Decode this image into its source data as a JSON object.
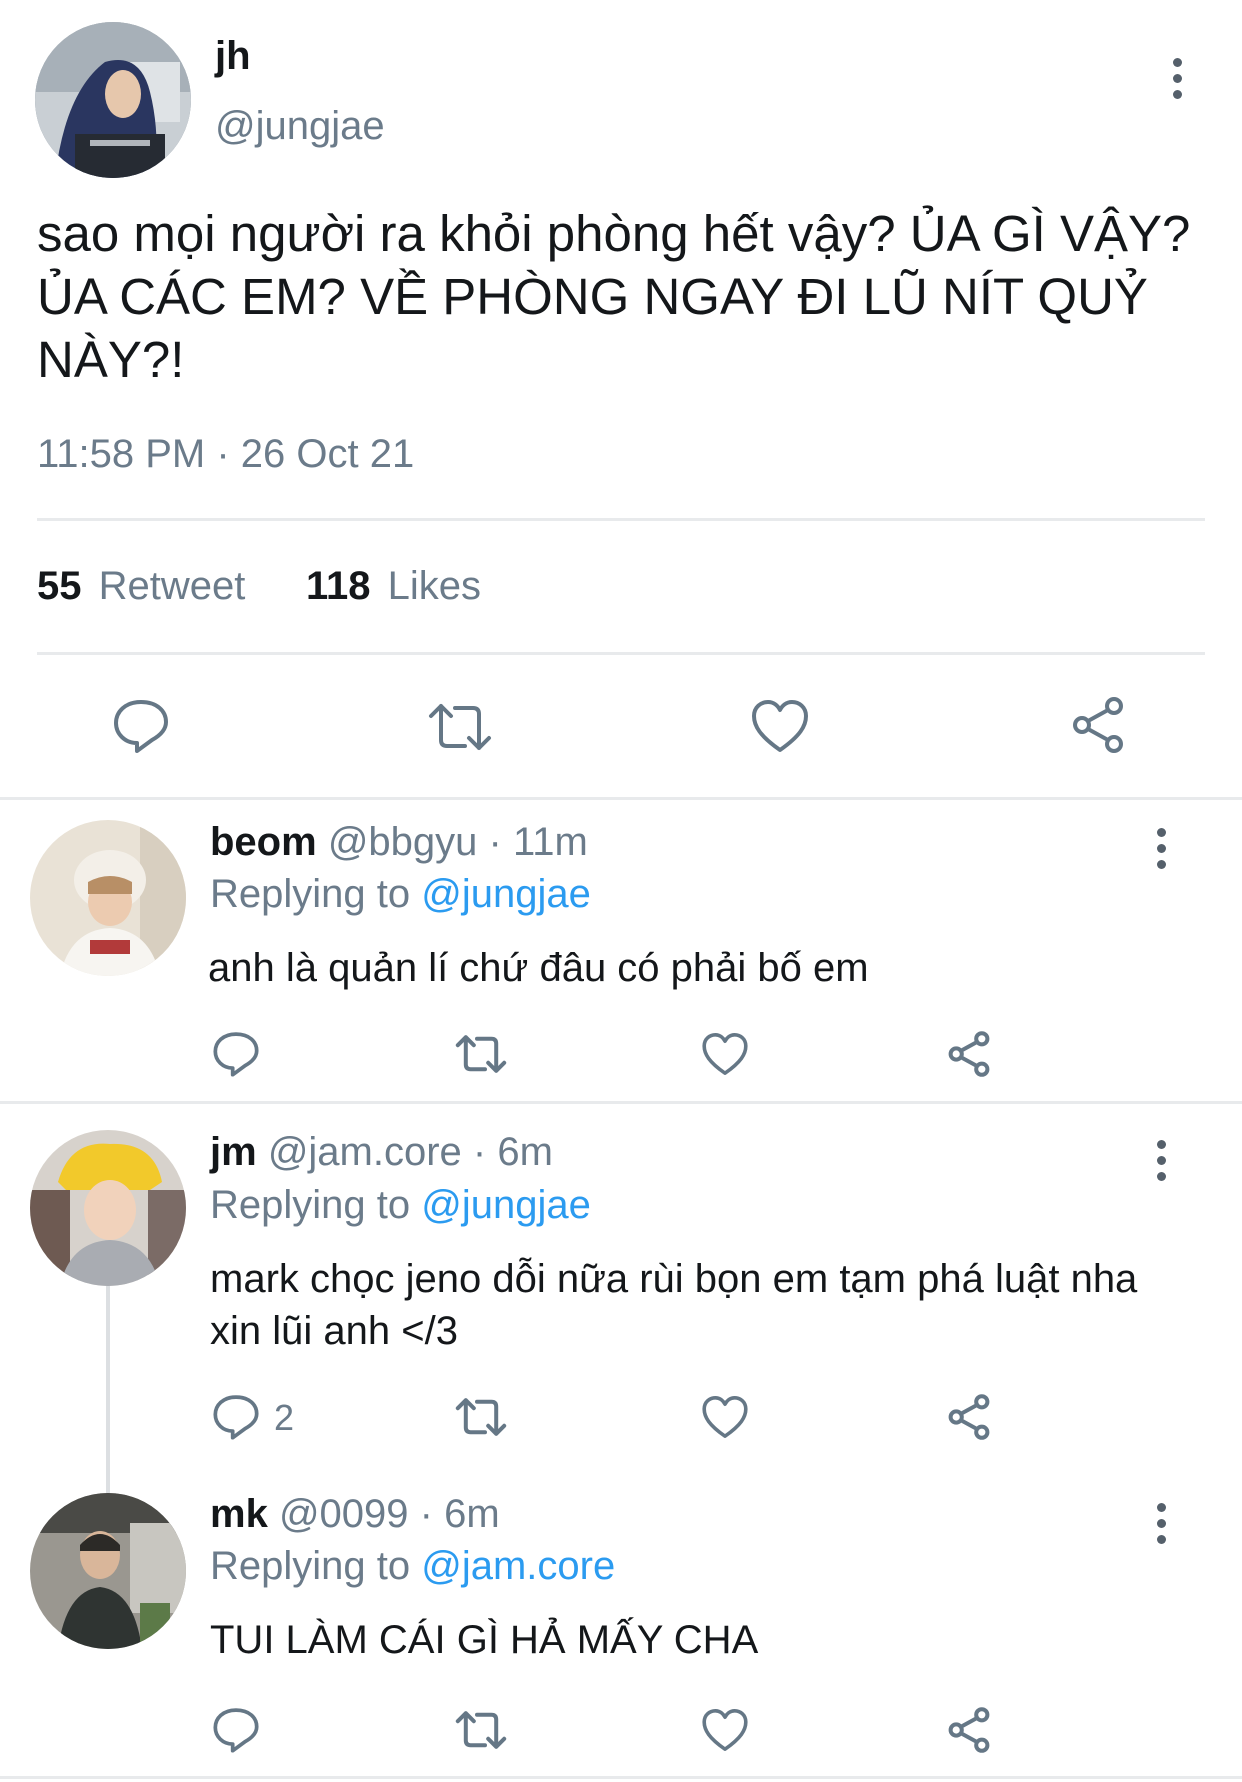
{
  "main_tweet": {
    "display_name": "jh",
    "handle": "@jungjae",
    "text": "sao mọi người ra khỏi phòng hết vậy? ỦA GÌ VẬY? ỦA CÁC EM? VỀ PHÒNG NGAY ĐI LŨ NÍT QUỶ NÀY?!",
    "timestamp": "11:58 PM · 26 Oct 21",
    "retweet_count": "55",
    "retweet_label": "Retweet",
    "like_count": "118",
    "like_label": "Likes"
  },
  "replies": [
    {
      "display_name": "beom",
      "meta": "@bbgyu · 11m",
      "replying_label": "Replying to",
      "replying_handle": "@jungjae",
      "text": "anh là quản lí chứ đâu có phải bố em",
      "reply_count": ""
    },
    {
      "display_name": "jm",
      "meta": "@jam.core · 6m",
      "replying_label": "Replying to",
      "replying_handle": "@jungjae",
      "text": "mark chọc jeno dỗi nữa rùi bọn em tạm phá luật nha xin lũi anh </3",
      "reply_count": "2"
    },
    {
      "display_name": "mk",
      "meta": "@0099 · 6m",
      "replying_label": "Replying to",
      "replying_handle": "@jam.core",
      "text": "TUI LÀM CÁI GÌ HẢ MẤY CHA",
      "reply_count": ""
    }
  ],
  "icons": [
    "more-vertical-icon",
    "reply-icon",
    "retweet-icon",
    "like-icon",
    "share-icon"
  ],
  "colors": {
    "link": "#2b9bf0",
    "muted": "#6b7b8a",
    "text": "#14171a",
    "divider": "#e8eaec"
  }
}
